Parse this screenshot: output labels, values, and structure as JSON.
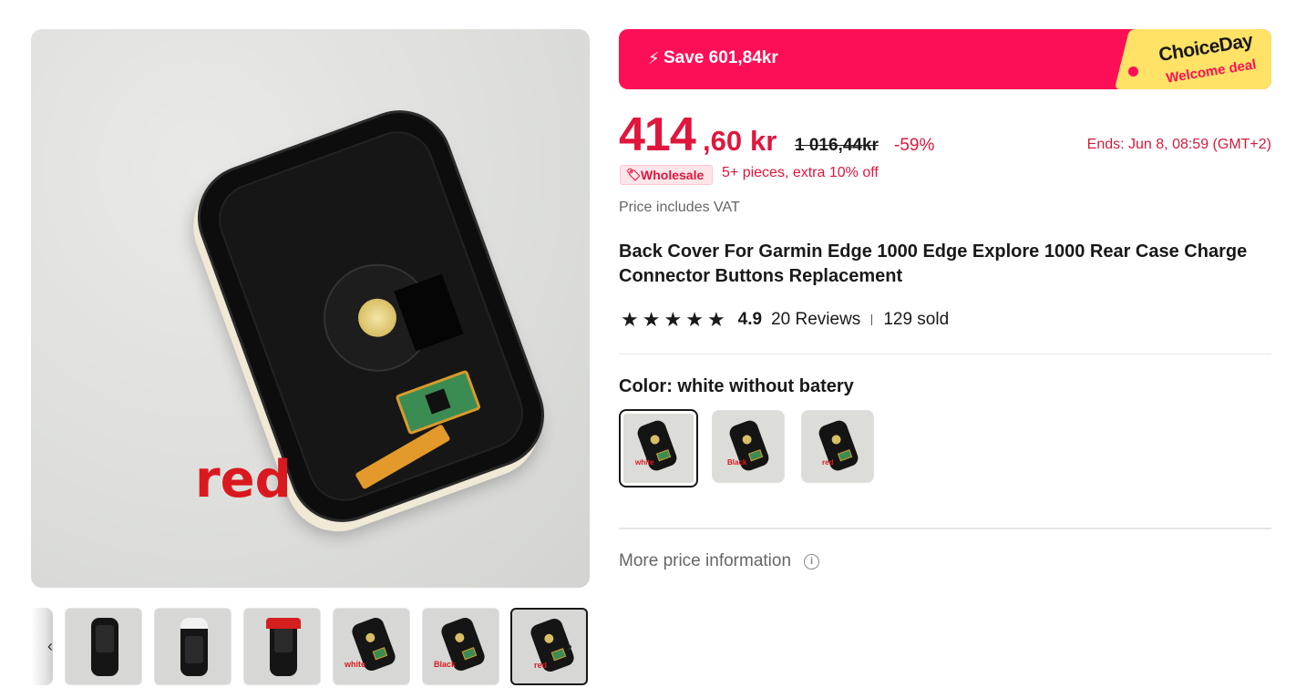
{
  "gallery": {
    "main_caption": "red",
    "thumb_captions": [
      "",
      "",
      "",
      "white",
      "Black",
      "red"
    ],
    "prev_icon": "chevron-left-icon",
    "next_icon": "chevron-right-icon"
  },
  "banner": {
    "bolt_icon": "⚡",
    "save_text": "Save 601,84kr",
    "choice_title": "ChoiceDay",
    "choice_sub": "Welcome deal",
    "bg_color": "#fd0f57",
    "tag_color": "#ffe266"
  },
  "price": {
    "integer": "414",
    "decimal": ",60",
    "currency": "kr",
    "original": "1 016,44kr",
    "discount": "-59%",
    "ends": "Ends: Jun 8, 08:59 (GMT+2)",
    "accent_color": "#e0163d"
  },
  "wholesale": {
    "badge": "Wholesale",
    "text": "5+ pieces, extra 10% off"
  },
  "vat_note": "Price includes VAT",
  "product": {
    "title": "Back Cover For Garmin Edge 1000 Edge Explore 1000 Rear Case Charge Connector Buttons Replacement"
  },
  "rating": {
    "stars": 5,
    "value": "4.9",
    "reviews": "20 Reviews",
    "sold": "129 sold"
  },
  "color": {
    "label": "Color: white without batery",
    "options": [
      {
        "caption": "white",
        "selected": true
      },
      {
        "caption": "Black",
        "selected": false
      },
      {
        "caption": "red",
        "selected": false
      }
    ]
  },
  "more_price_info": {
    "label": "More price information",
    "icon": "ⓘ"
  }
}
